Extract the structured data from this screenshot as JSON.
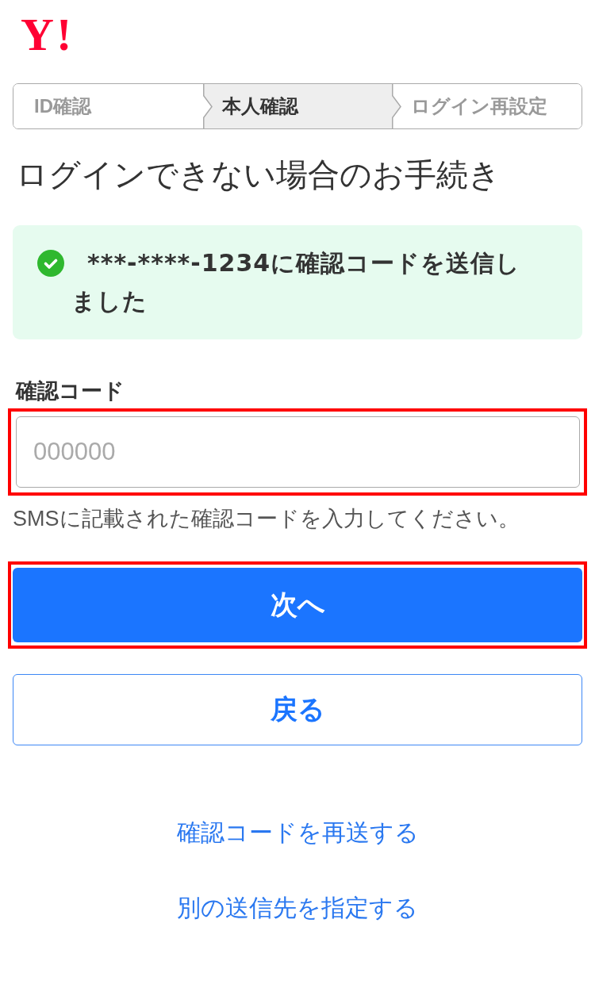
{
  "logo": {
    "text": "Y!"
  },
  "steps": [
    {
      "label": "ID確認",
      "current": false
    },
    {
      "label": "本人確認",
      "current": true
    },
    {
      "label": "ログイン再設定",
      "current": false
    }
  ],
  "title": "ログインできない場合のお手続き",
  "notice": {
    "kind": "success",
    "message": "***-****-1234に確認コードを送信しました"
  },
  "code_field": {
    "label": "確認コード",
    "placeholder": "000000",
    "highlighted": true,
    "help": "SMSに記載された確認コードを入力してください。"
  },
  "buttons": [
    {
      "label": "次へ",
      "kind": "primary",
      "highlighted": true
    },
    {
      "label": "戻る",
      "kind": "outline",
      "highlighted": false
    }
  ],
  "links": [
    "確認コードを再送する",
    "別の送信先を指定する"
  ]
}
